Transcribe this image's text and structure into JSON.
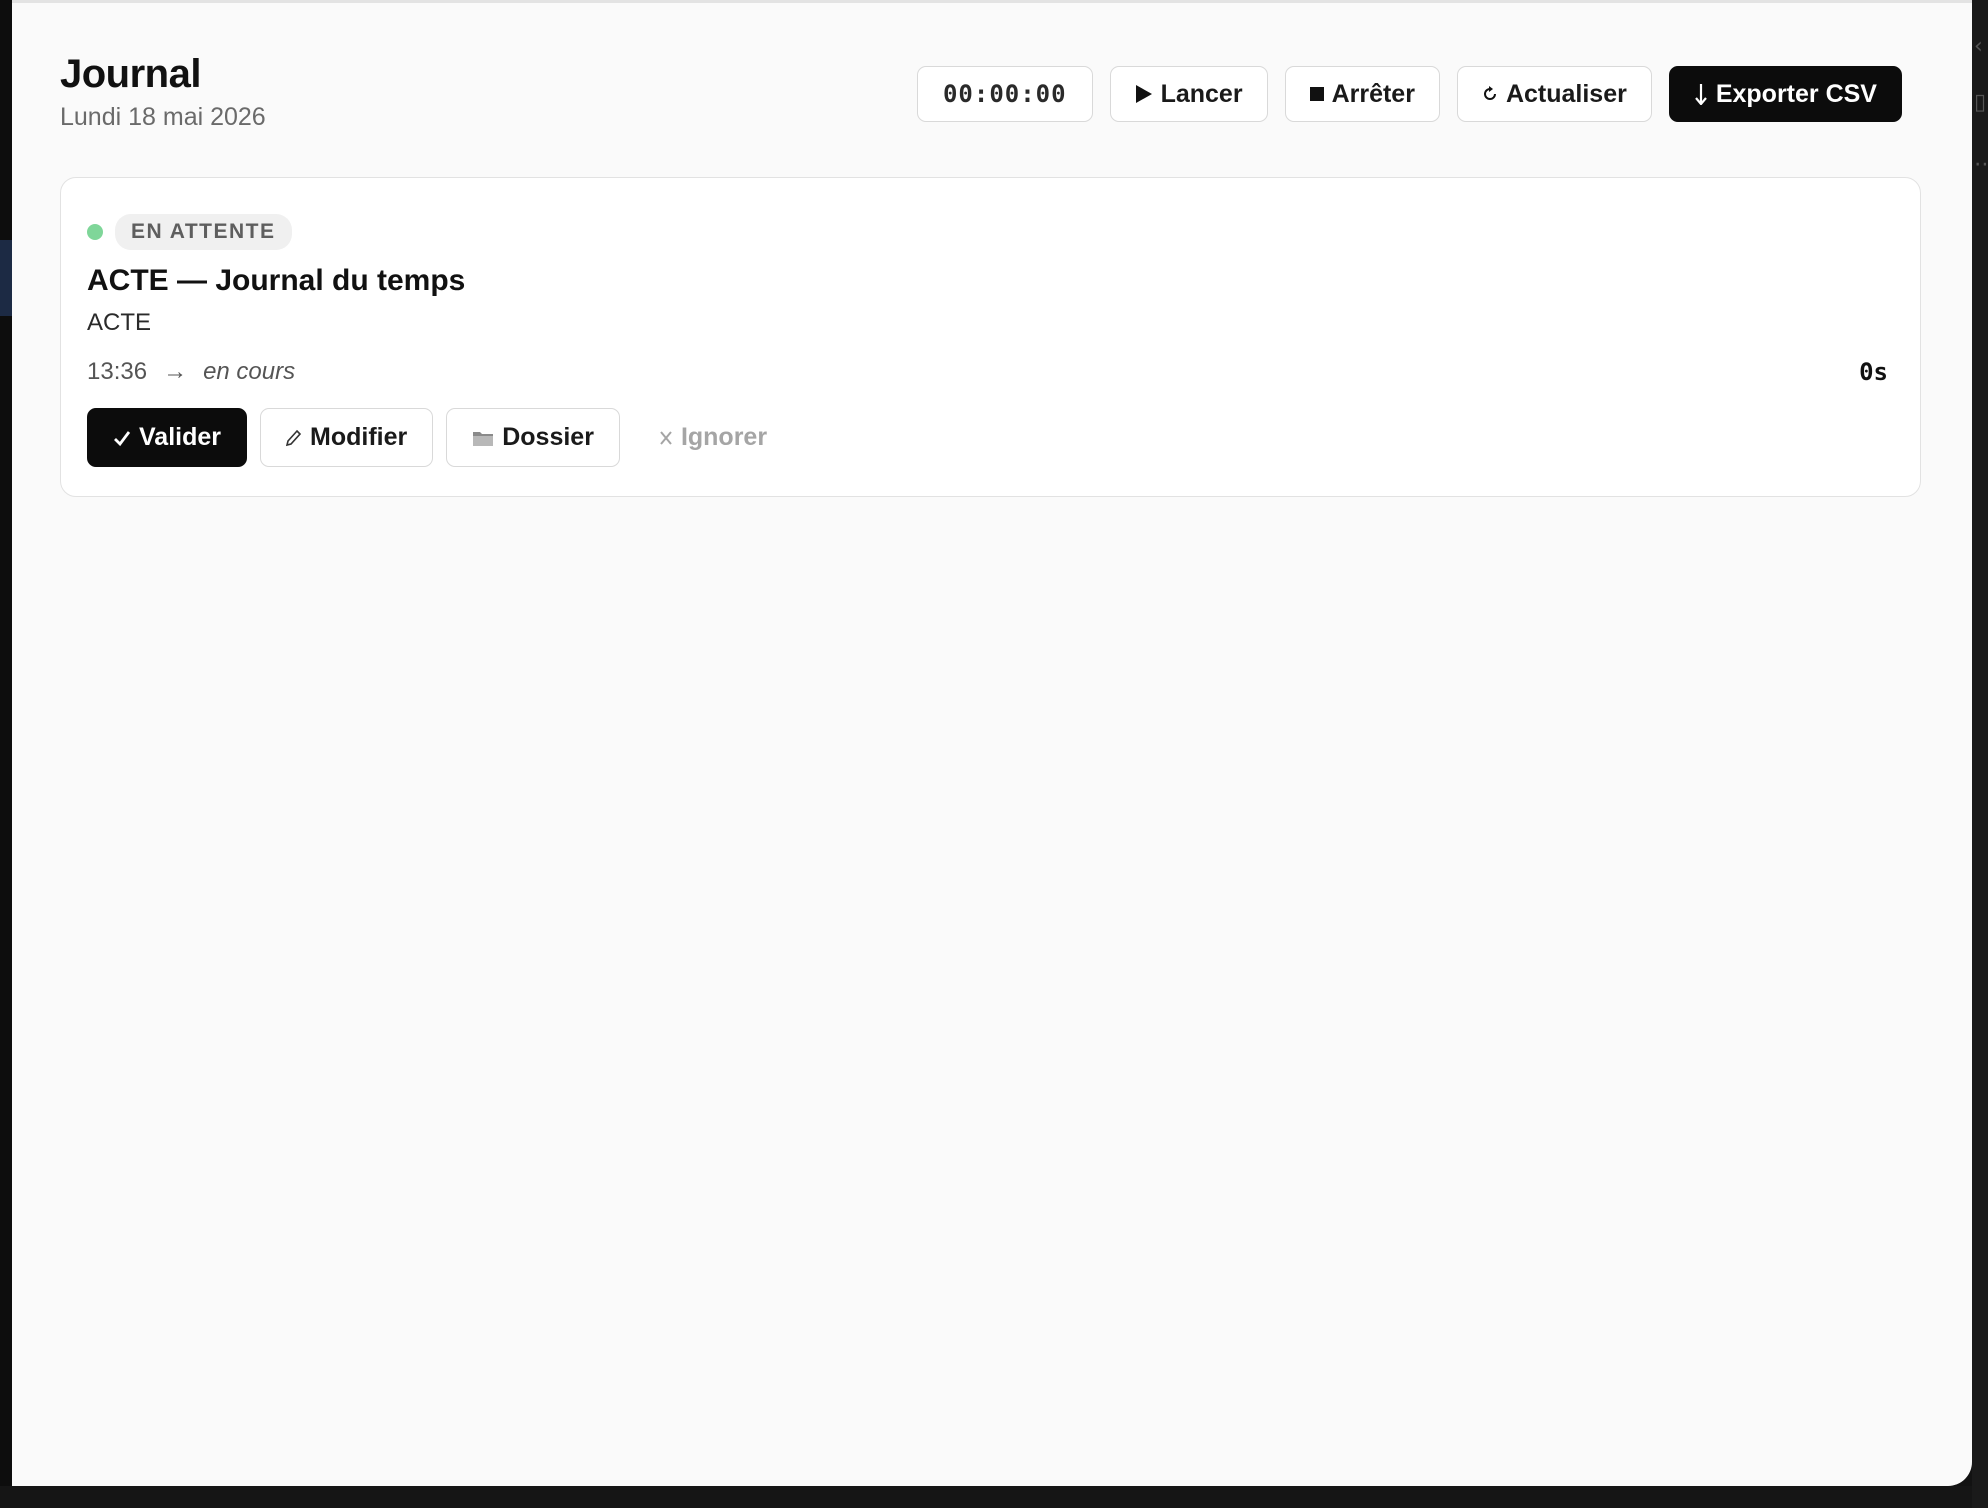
{
  "header": {
    "title": "Journal",
    "date": "Lundi 18 mai 2026"
  },
  "toolbar": {
    "timer": "00:00:00",
    "start_label": "Lancer",
    "stop_label": "Arrêter",
    "refresh_label": "Actualiser",
    "export_label": "Exporter CSV"
  },
  "entry": {
    "status": "EN ATTENTE",
    "status_color": "#7fd699",
    "title": "ACTE — Journal du temps",
    "subtitle": "ACTE",
    "start_time": "13:36",
    "arrow": "→",
    "end_status": "en cours",
    "duration": "0s",
    "actions": {
      "validate": "Valider",
      "edit": "Modifier",
      "folder": "Dossier",
      "ignore": "Ignorer"
    }
  },
  "icons": {
    "start": "play-icon",
    "stop": "stop-icon",
    "refresh": "refresh-icon",
    "export": "download-arrow-icon",
    "validate": "checkmark-icon",
    "edit": "pencil-icon",
    "folder": "folder-icon",
    "ignore": "cross-icon"
  }
}
